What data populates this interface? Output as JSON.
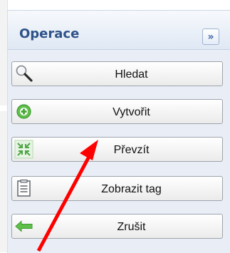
{
  "panel": {
    "title": "Operace",
    "collapse_glyph": "»"
  },
  "buttons": [
    {
      "label": "Hledat",
      "icon": "magnifier-icon"
    },
    {
      "label": "Vytvořit",
      "icon": "green-plus-icon"
    },
    {
      "label": "Převzít",
      "icon": "take-over-arrows-icon"
    },
    {
      "label": "Zobrazit tag",
      "icon": "document-icon"
    },
    {
      "label": "Zrušit",
      "icon": "green-left-arrow-icon"
    }
  ],
  "colors": {
    "title": "#2d5288",
    "panel_bg": "#e9eef6",
    "annotation_arrow": "#ff0000"
  }
}
